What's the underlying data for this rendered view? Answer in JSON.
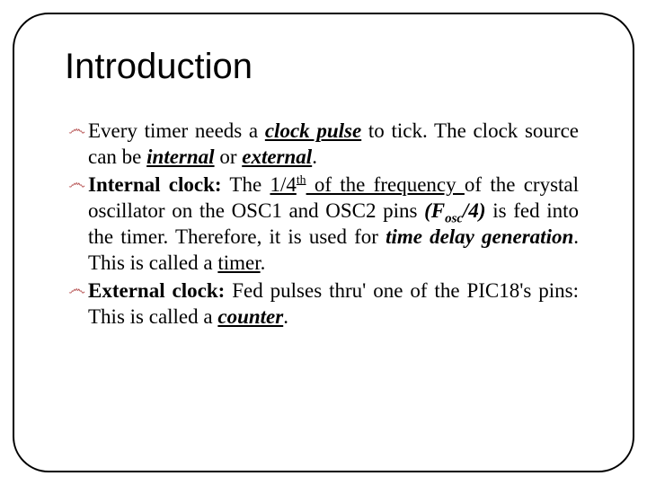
{
  "title": "Introduction",
  "bullets": {
    "b1": {
      "t1": "Every timer needs a ",
      "clock_pulse": "clock pulse",
      "t2": " to tick. The clock source can be ",
      "internal": "internal",
      "t3": " or ",
      "external": "external",
      "t4": "."
    },
    "b2": {
      "label": "Internal clock:",
      "t1": " The ",
      "frac": "1/4",
      "th": "th",
      "of_freq": " of the frequency ",
      "t2": "of the crystal oscillator on the OSC1 and OSC2 pins ",
      "fosc_open": "(F",
      "fosc_sub": "osc",
      "fosc_close": "/4)",
      "t3": " is fed into the timer. Therefore, it is used for ",
      "time_delay": "time delay generation",
      "t4": ". This is called a ",
      "timer": "timer",
      "t5": "."
    },
    "b3": {
      "label": "External clock:",
      "t1": " Fed pulses thru' one of the PIC18's pins: This is called a ",
      "counter": "counter",
      "t2": "."
    }
  },
  "bullet_glyph": "෴"
}
